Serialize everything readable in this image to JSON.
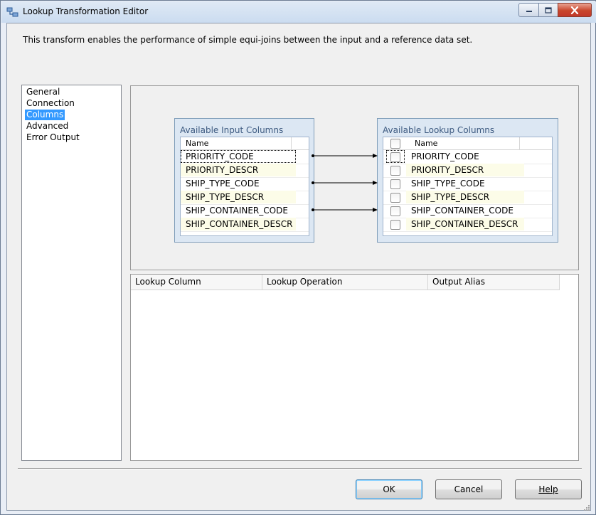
{
  "window": {
    "title": "Lookup Transformation Editor",
    "icons": {
      "app": "lookup-transform-icon",
      "minimize": "minimize-icon",
      "maximize": "maximize-icon",
      "close": "close-icon"
    }
  },
  "description": "This transform enables the performance of simple equi-joins between the input and a reference data set.",
  "nav": {
    "items": [
      "General",
      "Connection",
      "Columns",
      "Advanced",
      "Error Output"
    ],
    "selected": "Columns"
  },
  "input_columns": {
    "title": "Available Input Columns",
    "header": "Name",
    "rows": [
      "PRIORITY_CODE",
      "PRIORITY_DESCR",
      "SHIP_TYPE_CODE",
      "SHIP_TYPE_DESCR",
      "SHIP_CONTAINER_CODE",
      "SHIP_CONTAINER_DESCR"
    ]
  },
  "lookup_columns": {
    "title": "Available Lookup Columns",
    "header": "Name",
    "rows": [
      "PRIORITY_CODE",
      "PRIORITY_DESCR",
      "SHIP_TYPE_CODE",
      "SHIP_TYPE_DESCR",
      "SHIP_CONTAINER_CODE",
      "SHIP_CONTAINER_DESCR"
    ],
    "checked": [
      false,
      false,
      false,
      false,
      false,
      false
    ]
  },
  "mappings": [
    {
      "from": "PRIORITY_CODE",
      "to": "PRIORITY_CODE"
    },
    {
      "from": "SHIP_TYPE_CODE",
      "to": "SHIP_TYPE_CODE"
    },
    {
      "from": "SHIP_CONTAINER_CODE",
      "to": "SHIP_CONTAINER_CODE"
    }
  ],
  "output_grid": {
    "columns": [
      "Lookup Column",
      "Lookup Operation",
      "Output Alias"
    ]
  },
  "buttons": {
    "ok": "OK",
    "cancel": "Cancel",
    "help": "Help"
  },
  "colors": {
    "selection": "#3399ff",
    "alt_row": "#fcfce8",
    "column_box": "#dce7f3",
    "close_button": "#c9462c"
  }
}
